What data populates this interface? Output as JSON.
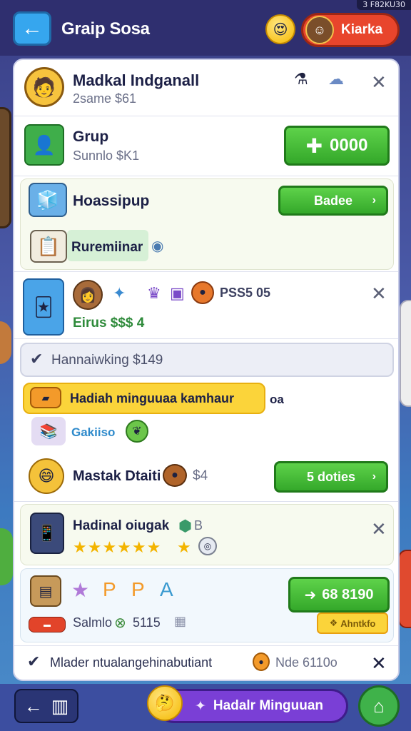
{
  "corner_tag": "3 F82KU30",
  "header": {
    "title": "Graip Sosa",
    "profile_name": "Kiarka"
  },
  "rows": {
    "r1": {
      "title": "Madkal Indganall",
      "sub": "2same $61"
    },
    "r2": {
      "title": "Grup",
      "sub": "Sunnlo $K1",
      "button": "0000"
    },
    "r3": {
      "title": "Hoassipup",
      "button": "Badee",
      "label": "Ruremiinar"
    },
    "r4": {
      "price": "PSS5 05",
      "sub": "Eirus $$$ 4"
    },
    "r5": {
      "strip": "Hannaiwking $149"
    },
    "r6": {
      "banner": "Hadiah minguuaa kamhaur",
      "banner_tail": "oa",
      "sub": "Gakiiso"
    },
    "r7": {
      "title": "Mastak Dtaiti",
      "value": "$4",
      "button": "5 doties"
    },
    "r8": {
      "title": "Hadinal oiugak",
      "code": "B",
      "stars": "★★★★★★",
      "rating": 6
    },
    "r9": {
      "button": "68 8190",
      "sub": "Salmlo",
      "value": "5115",
      "badge": "Ahntkfo"
    },
    "r10": {
      "text": "Mlader ntualangehinabutiant",
      "tail": "Nde 6110o"
    }
  },
  "footer": {
    "action_label": "Hadalr Minguuan"
  },
  "colors": {
    "accent_green": "#34a82a",
    "accent_purple": "#7a3fd6",
    "accent_red": "#e8452c",
    "accent_blue": "#36a6ee"
  }
}
